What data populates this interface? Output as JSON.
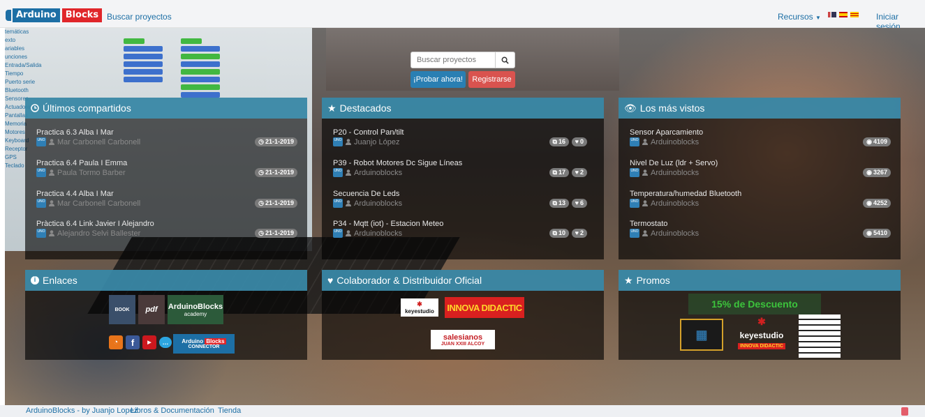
{
  "brand": {
    "part1": "Arduino",
    "part2": "Blocks"
  },
  "nav": {
    "search_link": "Buscar proyectos",
    "resources": "Recursos",
    "login": "Iniciar sesión"
  },
  "background": {
    "sidebar": [
      "temáticas",
      "exto",
      "ariables",
      "unciones",
      "Entrada/Salida",
      "Tiempo",
      "Puerto serie",
      "Bluetooth",
      "Sensores",
      "Actuadores",
      "Pantallas",
      "Memoria",
      "Motores",
      "Keyboard",
      "Receptor",
      "GPS",
      "Teclado"
    ]
  },
  "hero": {
    "search_placeholder": "Buscar proyectos",
    "try_button": "¡Probar ahora!",
    "register_button": "Registrarse"
  },
  "panels": {
    "latest": {
      "title": "Últimos compartidos",
      "items": [
        {
          "title": "Practica 6.3 Alba I Mar",
          "owner": "Mar Carbonell Carbonell",
          "date": "21-1-2019"
        },
        {
          "title": "Practica 6.4 Paula I Emma",
          "owner": "Paula Tormo Barber",
          "date": "21-1-2019"
        },
        {
          "title": "Practica 4.4 Alba I Mar",
          "owner": "Mar Carbonell Carbonell",
          "date": "21-1-2019"
        },
        {
          "title": "Pràctica 6.4 Link Javier I Alejandro",
          "owner": "Alejandro Selvi Ballester",
          "date": "21-1-2019"
        }
      ]
    },
    "featured": {
      "title": "Destacados",
      "items": [
        {
          "title": "P20 - Control Pan/tilt",
          "owner": "Juanjo López",
          "copies": "16",
          "likes": "0"
        },
        {
          "title": "P39 - Robot Motores Dc Sigue Líneas",
          "owner": "Arduinoblocks",
          "copies": "17",
          "likes": "2"
        },
        {
          "title": "Secuencia De Leds",
          "owner": "Arduinoblocks",
          "copies": "13",
          "likes": "6"
        },
        {
          "title": "P34 - Mqtt (iot) - Estacion Meteo",
          "owner": "Arduinoblocks",
          "copies": "10",
          "likes": "2"
        }
      ]
    },
    "most_viewed": {
      "title": "Los más vistos",
      "items": [
        {
          "title": "Sensor Aparcamiento",
          "owner": "Arduinoblocks",
          "views": "4109"
        },
        {
          "title": "Nivel De Luz (ldr + Servo)",
          "owner": "Arduinoblocks",
          "views": "3267"
        },
        {
          "title": "Temperatura/humedad Bluetooth",
          "owner": "Arduinoblocks",
          "views": "4252"
        },
        {
          "title": "Termostato",
          "owner": "Arduinoblocks",
          "views": "5410"
        }
      ]
    },
    "links": {
      "title": "Enlaces",
      "academy_line1": "ArduinoBlocks",
      "academy_line2": "academy",
      "pdf_label": "pdf",
      "connector_label": "CONNECTOR"
    },
    "partner": {
      "title": "Colaborador & Distribuidor Oficial",
      "keyestudio": "keyestudio",
      "innova": "INNOVA DIDACTIC",
      "salesianos_line1": "salesianos",
      "salesianos_line2": "JUAN XXIII  ALCOY"
    },
    "promos": {
      "title": "Promos",
      "discount": "15% de Descuento",
      "keyestudio": "keyestudio",
      "innova": "INNOVA DIDACTIC"
    }
  },
  "footer": {
    "credit": "ArduinoBlocks - by Juanjo Lopez",
    "docs": "Libros & Documentación",
    "shop": "Tienda"
  },
  "colors": {
    "primary": "#1d6fa5",
    "danger": "#e0262a",
    "panel_header": "#3e96b9"
  }
}
